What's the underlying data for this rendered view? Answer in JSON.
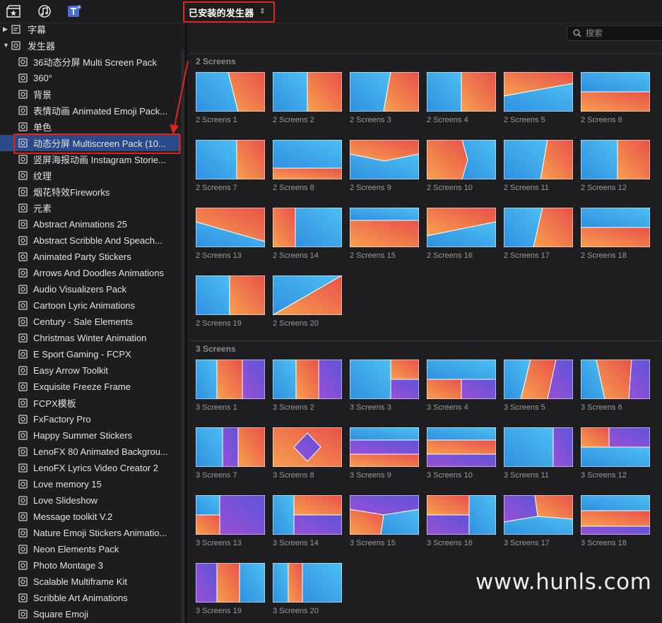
{
  "toolbar": {
    "icons": [
      "clapper-star-icon",
      "music-loop-icon",
      "titles-t-icon"
    ],
    "dropdown_label": "已安装的发生器",
    "dropdown_chevron": "⌃⌄"
  },
  "sidebar": {
    "captions_label": "字幕",
    "generators_label": "发生器",
    "items": [
      "36动态分屏 Multi Screen Pack",
      "360°",
      "背景",
      "表情动画 Animated Emoji Pack...",
      "单色",
      "动态分屏 Multiscreen Pack (10...",
      "竖屏海报动画 Instagram Storie...",
      "纹理",
      "烟花特效Fireworks",
      "元素",
      "Abstract Animations 25",
      "Abstract Scribble And Speach...",
      "Animated Party Stickers",
      "Arrows And Doodles Animations",
      "Audio Visualizers Pack",
      "Cartoon Lyric Animations",
      "Century - Sale Elements",
      "Christmas Winter Animation",
      "E Sport Gaming - FCPX",
      "Easy Arrow Toolkit",
      "Exquisite Freeze Frame",
      "FCPX模板",
      "FxFactory Pro",
      "Happy Summer Stickers",
      "LenoFX 80 Animated Backgrou...",
      "LenoFX Lyrics Video Creator 2",
      "Love memory 15",
      "Love Slideshow",
      "Message toolkit V.2",
      "Nature Emoji Stickers Animatio...",
      "Neon Elements Pack",
      "Photo Montage 3",
      "Scalable Multiframe Kit",
      "Scribble Art Animations",
      "Square Emoji"
    ],
    "selected_index": 5
  },
  "search": {
    "placeholder": "搜索"
  },
  "sections": [
    {
      "title": "2 Screens",
      "tiles": [
        "2 Screens 1",
        "2 Screens 2",
        "2 Screens 3",
        "2 Screens 4",
        "2 Screens 5",
        "2 Screens 6",
        "2 Screens 7",
        "2 Screens 8",
        "2 Screens 9",
        "2 Screens 10",
        "2 Screens 11",
        "2 Screens 12",
        "2 Screens 13",
        "2 Screens 14",
        "2 Screens 15",
        "2 Screens 16",
        "2 Screens 17",
        "2 Screens 18",
        "2 Screens 19",
        "2 Screens 20"
      ]
    },
    {
      "title": "3 Screens",
      "tiles": [
        "3 Screens 1",
        "3 Screens 2",
        "3 Screens 3",
        "3 Screens 4",
        "3 Screens 5",
        "3 Screens 6",
        "3 Screens 7",
        "3 Screens 8",
        "3 Screens 9",
        "3 Screens 10",
        "3 Screens 11",
        "3 Screens 12",
        "3 Screens 13",
        "3 Screens 14",
        "3 Screens 15",
        "3 Screens 16",
        "3 Screens 17",
        "3 Screens 18",
        "3 Screens 19",
        "3 Screens 20"
      ]
    }
  ],
  "watermark": "www.hunls.com",
  "colors": {
    "accent_red": "#e0241c",
    "selection_blue": "#2b4a8a",
    "thumb_blue": "#3aa3e6",
    "thumb_orange": "#f0744a",
    "thumb_purple": "#7b4fd0"
  }
}
